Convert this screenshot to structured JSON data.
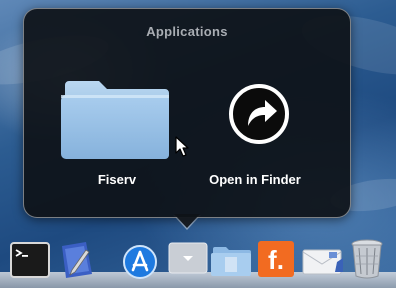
{
  "stack": {
    "title": "Applications",
    "items": [
      {
        "label": "Fiserv",
        "icon": "folder-icon"
      },
      {
        "label": "Open in Finder",
        "icon": "open-in-finder-icon"
      }
    ]
  },
  "dock": {
    "items": [
      {
        "icon": "terminal-icon"
      },
      {
        "icon": "textedit-icon"
      },
      {
        "icon": "app-store-icon"
      },
      {
        "icon": "stack-arrow-icon"
      },
      {
        "icon": "documents-folder-icon"
      },
      {
        "icon": "f-app-icon",
        "glyph": "f."
      },
      {
        "icon": "mail-envelope-icon"
      },
      {
        "icon": "trash-icon"
      }
    ]
  },
  "colors": {
    "popover_bg": "#0e1218",
    "folder_blue": "#9fc4e6",
    "orange": "#f26b21"
  }
}
